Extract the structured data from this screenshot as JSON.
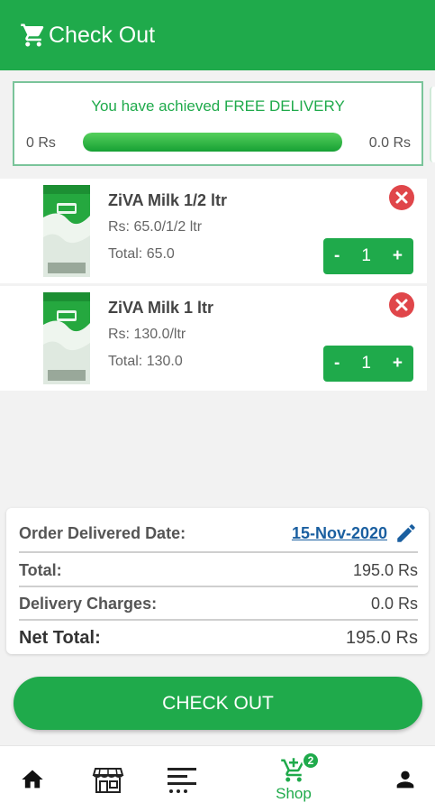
{
  "header": {
    "title": "Check Out",
    "icon": "cart-icon",
    "color": "#1faa4b"
  },
  "delivery_banner": {
    "message": "You have achieved FREE DELIVERY",
    "min_label": "0 Rs",
    "max_label": "0.0 Rs",
    "progress_fraction": 1.0
  },
  "cart": {
    "items": [
      {
        "name": "ZiVA Milk 1/2 ltr",
        "price": "Rs: 65.0/1/2 ltr",
        "total": "Total: 65.0",
        "quantity": "1",
        "minus": "-",
        "plus": "+"
      },
      {
        "name": "ZiVA Milk 1 ltr",
        "price": "Rs: 130.0/ltr",
        "total": "Total: 130.0",
        "quantity": "1",
        "minus": "-",
        "plus": "+"
      }
    ]
  },
  "summary": {
    "delivered_date_label": "Order Delivered Date:",
    "delivered_date": "15-Nov-2020",
    "total_label": "Total:",
    "total_value": "195.0 Rs",
    "delivery_label": "Delivery Charges:",
    "delivery_value": "0.0 Rs",
    "net_label": "Net Total:",
    "net_value": "195.0 Rs"
  },
  "checkout_button": "CHECK OUT",
  "bottom_nav": {
    "items": [
      {
        "icon": "home-icon"
      },
      {
        "icon": "store-icon"
      },
      {
        "icon": "categories-icon"
      },
      {
        "icon": "cart-add-icon",
        "label": "Shop",
        "badge": "2",
        "active": true
      },
      {
        "icon": "person-icon"
      }
    ]
  },
  "colors": {
    "primary": "#1faa4b",
    "danger": "#e0464a",
    "link": "#1a5fa0"
  }
}
